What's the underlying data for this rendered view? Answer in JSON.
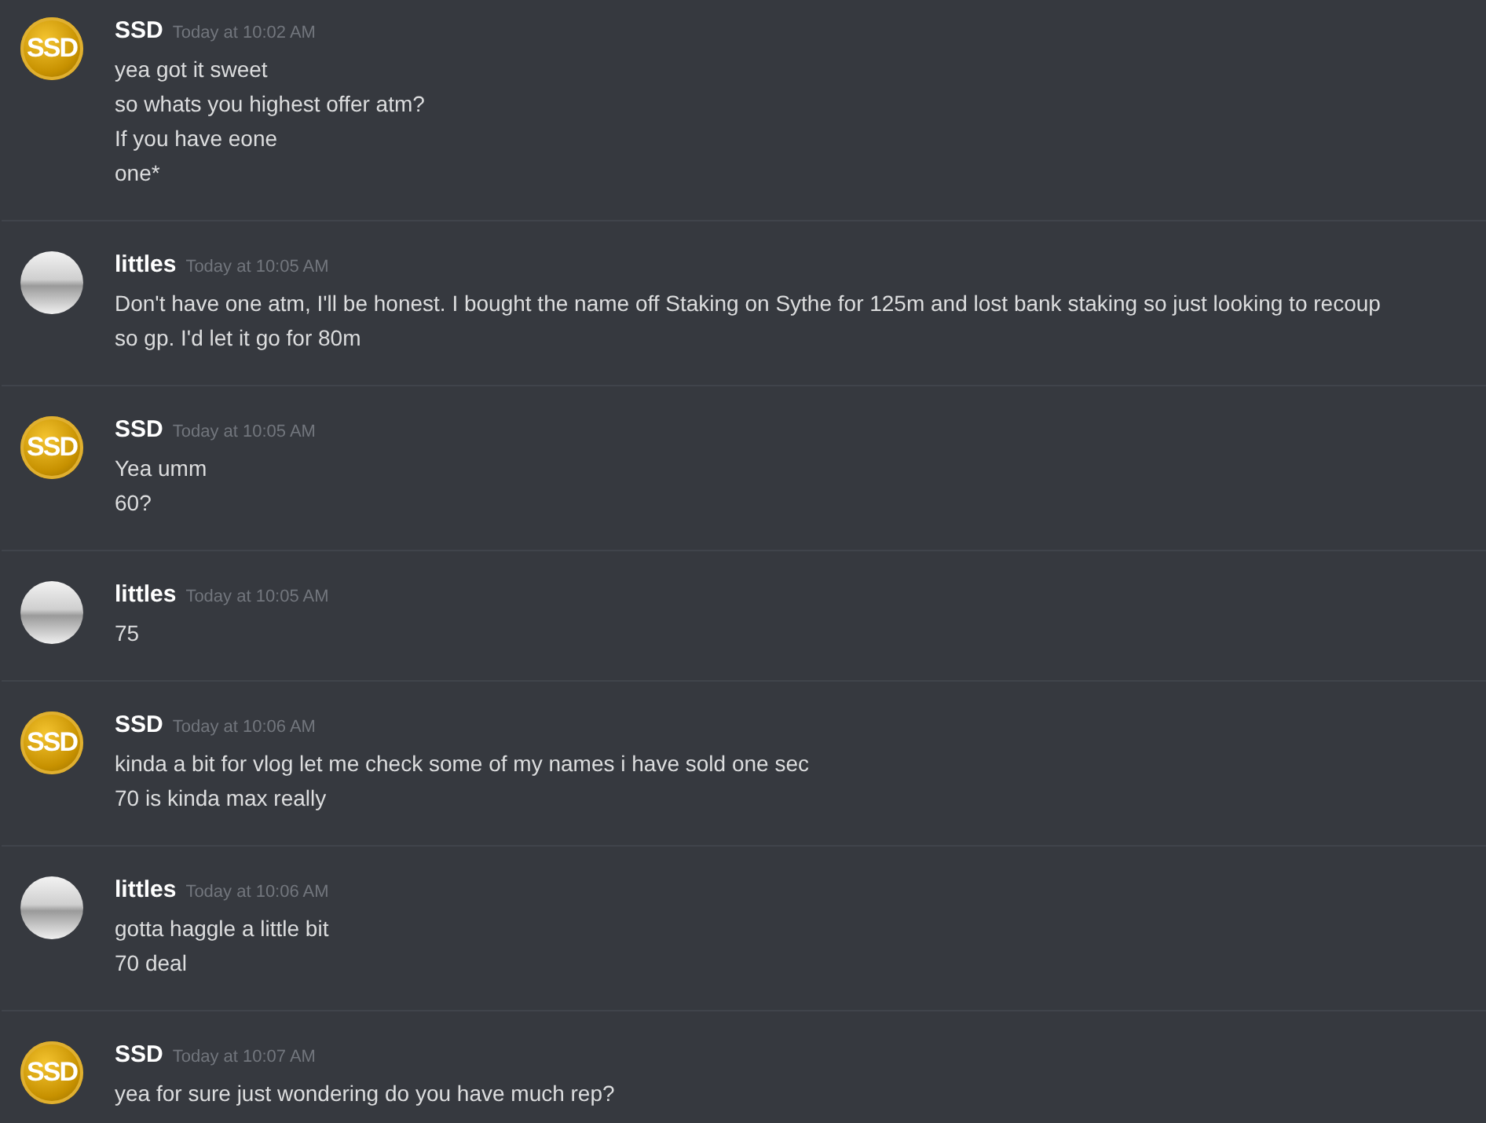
{
  "messages": [
    {
      "author": "SSD",
      "avatar": {
        "kind": "logo",
        "label": "SSD"
      },
      "timestamp": "Today at 10:02 AM",
      "lines": [
        "yea got it sweet",
        "so whats you highest offer atm?",
        "If you have eone",
        "one*"
      ]
    },
    {
      "author": "littles",
      "avatar": {
        "kind": "picture"
      },
      "timestamp": "Today at 10:05 AM",
      "lines": [
        "Don't have one atm, I'll be honest. I bought the name off Staking on Sythe for 125m and lost bank staking so just looking to recoup so gp. I'd let it go for 80m"
      ]
    },
    {
      "author": "SSD",
      "avatar": {
        "kind": "logo",
        "label": "SSD"
      },
      "timestamp": "Today at 10:05 AM",
      "lines": [
        "Yea umm",
        "60?"
      ]
    },
    {
      "author": "littles",
      "avatar": {
        "kind": "picture"
      },
      "timestamp": "Today at 10:05 AM",
      "lines": [
        "75"
      ]
    },
    {
      "author": "SSD",
      "avatar": {
        "kind": "logo",
        "label": "SSD"
      },
      "timestamp": "Today at 10:06 AM",
      "lines": [
        "kinda a bit for vlog let me check some of my names i have sold one sec",
        "70 is kinda max really"
      ]
    },
    {
      "author": "littles",
      "avatar": {
        "kind": "picture"
      },
      "timestamp": "Today at 10:06 AM",
      "lines": [
        "gotta haggle a little bit",
        "70 deal"
      ]
    },
    {
      "author": "SSD",
      "avatar": {
        "kind": "logo",
        "label": "SSD"
      },
      "timestamp": "Today at 10:07 AM",
      "lines": [
        "yea for sure just wondering do you have much rep?"
      ]
    }
  ]
}
